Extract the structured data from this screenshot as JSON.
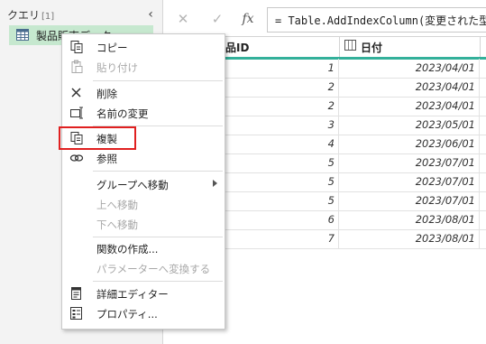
{
  "query_pane": {
    "title": "クエリ",
    "count": "[1]",
    "collapse_glyph": "‹",
    "item_label": "製品販売データ"
  },
  "formula_bar": {
    "cancel_glyph": "✕",
    "confirm_glyph": "✓",
    "fx_glyph": "fx",
    "formula": "= Table.AddIndexColumn(変更された型,"
  },
  "grid": {
    "columns": [
      {
        "label": "品ID"
      },
      {
        "label": "日付"
      }
    ],
    "rows": [
      {
        "id": "1",
        "date": "2023/04/01"
      },
      {
        "id": "2",
        "date": "2023/04/01"
      },
      {
        "id": "2",
        "date": "2023/04/01"
      },
      {
        "id": "3",
        "date": "2023/05/01"
      },
      {
        "id": "4",
        "date": "2023/06/01"
      },
      {
        "id": "5",
        "date": "2023/07/01"
      },
      {
        "id": "5",
        "date": "2023/07/01"
      },
      {
        "id": "5",
        "date": "2023/07/01"
      },
      {
        "id": "6",
        "date": "2023/08/01"
      },
      {
        "id": "7",
        "date": "2023/08/01"
      }
    ]
  },
  "context_menu": {
    "copy": "コピー",
    "paste": "貼り付け",
    "delete": "削除",
    "rename": "名前の変更",
    "duplicate": "複製",
    "reference": "参照",
    "move_to_group": "グループへ移動",
    "move_up": "上へ移動",
    "move_down": "下へ移動",
    "create_function": "関数の作成...",
    "convert_to_parameter": "パラメーターへ変換する",
    "advanced_editor": "詳細エディター",
    "properties": "プロパティ..."
  },
  "colors": {
    "selected_query": "#c6e8cf",
    "header_accent": "#33b09a",
    "highlight": "#e02020"
  }
}
